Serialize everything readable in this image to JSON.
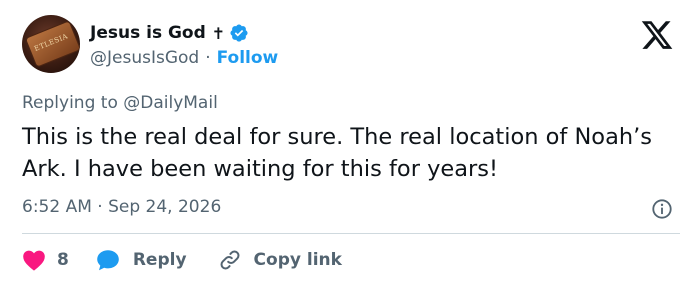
{
  "author": {
    "name": "Jesus is God",
    "cross_glyph": "✝",
    "handle": "@JesusIsGod",
    "separator": "·",
    "follow_label": "Follow",
    "avatar_text": "ETLESIA"
  },
  "reply_context": {
    "prefix": "Replying to ",
    "mention": "@DailyMail"
  },
  "tweet": {
    "text": "This is the real deal for sure. The real location of Noah’s Ark. I have been waiting for this for years!",
    "time": "6:52 AM",
    "separator": "·",
    "date": "Sep 24, 2026"
  },
  "actions": {
    "like_count": "8",
    "reply_label": "Reply",
    "copy_link_label": "Copy link"
  },
  "colors": {
    "accent": "#1d9bf0",
    "like": "#f91880",
    "text": "#0f1419",
    "muted": "#536471",
    "divider": "#cfd9de"
  },
  "icons": [
    "verified-badge-icon",
    "x-logo-icon",
    "info-icon",
    "heart-icon",
    "reply-bubble-icon",
    "link-icon"
  ]
}
